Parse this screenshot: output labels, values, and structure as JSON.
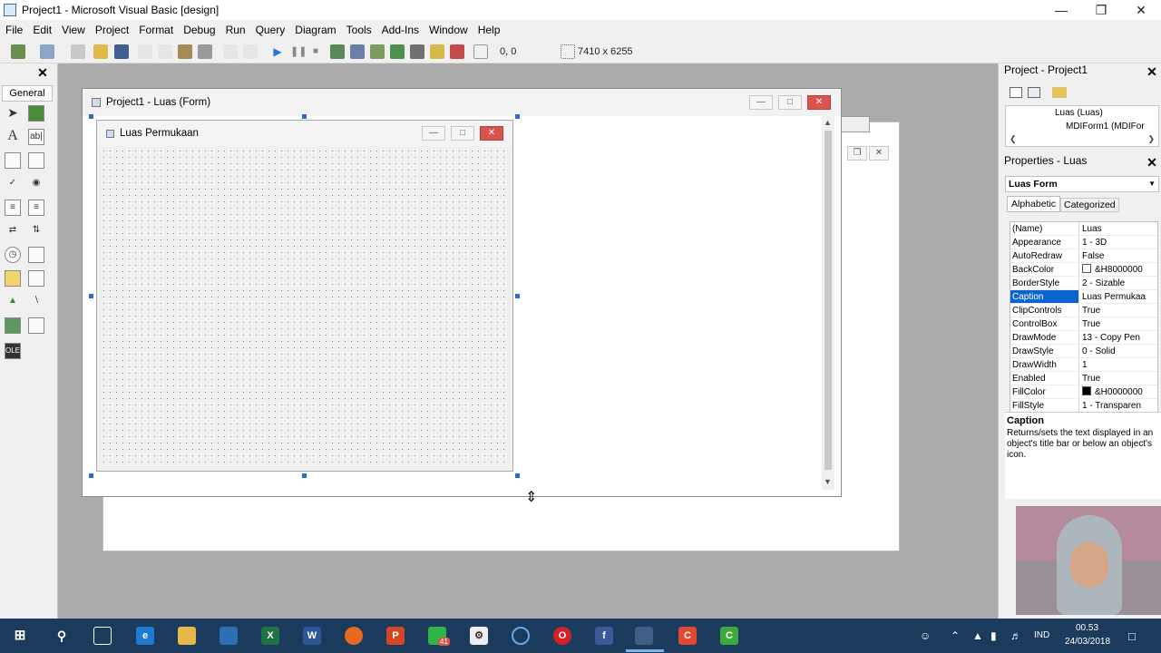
{
  "window": {
    "title": "Project1 - Microsoft Visual Basic [design]"
  },
  "menu": [
    "File",
    "Edit",
    "View",
    "Project",
    "Format",
    "Debug",
    "Run",
    "Query",
    "Diagram",
    "Tools",
    "Add-Ins",
    "Window",
    "Help"
  ],
  "toolbar": {
    "position": "0, 0",
    "size": "7410 x 6255"
  },
  "toolbox": {
    "tab": "General"
  },
  "form_designer": {
    "title": "Project1 - Luas (Form)",
    "form_caption": "Luas Permukaan"
  },
  "project_explorer": {
    "title": "Project - Project1",
    "items": [
      "Luas (Luas)",
      "MDIForm1 (MDIFor"
    ]
  },
  "properties": {
    "title": "Properties - Luas",
    "object": "Luas Form",
    "tabs": [
      "Alphabetic",
      "Categorized"
    ],
    "rows": [
      {
        "name": "(Name)",
        "value": "Luas"
      },
      {
        "name": "Appearance",
        "value": "1 - 3D"
      },
      {
        "name": "AutoRedraw",
        "value": "False"
      },
      {
        "name": "BackColor",
        "value": "&H8000000"
      },
      {
        "name": "BorderStyle",
        "value": "2 - Sizable"
      },
      {
        "name": "Caption",
        "value": "Luas Permukaa"
      },
      {
        "name": "ClipControls",
        "value": "True"
      },
      {
        "name": "ControlBox",
        "value": "True"
      },
      {
        "name": "DrawMode",
        "value": "13 - Copy Pen"
      },
      {
        "name": "DrawStyle",
        "value": "0 - Solid"
      },
      {
        "name": "DrawWidth",
        "value": "1"
      },
      {
        "name": "Enabled",
        "value": "True"
      },
      {
        "name": "FillColor",
        "value": "&H0000000"
      },
      {
        "name": "FillStyle",
        "value": "1 - Transparen"
      }
    ],
    "desc_title": "Caption",
    "desc_text": "Returns/sets the text displayed in an object's title bar or below an object's icon."
  },
  "taskbar": {
    "badge": "41",
    "lang": "IND",
    "time": "00.53",
    "date": "24/03/2018"
  },
  "colors": {
    "accent": "#0a64d0",
    "taskbar": "#1a3b5c",
    "mdi_bg": "#ababab"
  }
}
